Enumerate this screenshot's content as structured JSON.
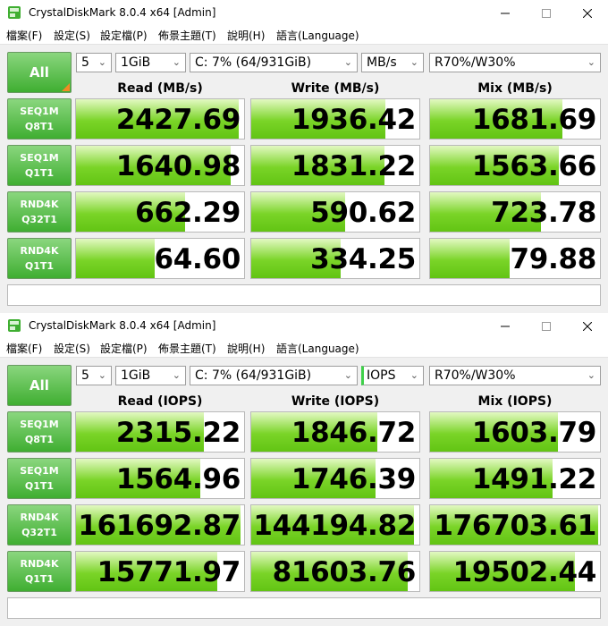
{
  "windows": [
    {
      "title": "CrystalDiskMark 8.0.4 x64 [Admin]",
      "menu": [
        "檔案(F)",
        "設定(S)",
        "設定檔(P)",
        "佈景主題(T)",
        "說明(H)",
        "語言(Language)"
      ],
      "all_label": "All",
      "controls": {
        "count": "5",
        "size": "1GiB",
        "drive": "C: 7% (64/931GiB)",
        "unit": "MB/s",
        "mix": "R70%/W30%"
      },
      "headers": {
        "read": "Read (MB/s)",
        "write": "Write (MB/s)",
        "mix": "Mix (MB/s)"
      },
      "rows": [
        {
          "l1": "SEQ1M",
          "l2": "Q8T1",
          "read": "2427.69",
          "write": "1936.42",
          "mix": "1681.69",
          "fill": [
            0.97,
            0.8,
            0.78
          ]
        },
        {
          "l1": "SEQ1M",
          "l2": "Q1T1",
          "read": "1640.98",
          "write": "1831.22",
          "mix": "1563.66",
          "fill": [
            0.92,
            0.79,
            0.76
          ]
        },
        {
          "l1": "RND4K",
          "l2": "Q32T1",
          "read": "662.29",
          "write": "590.62",
          "mix": "723.78",
          "fill": [
            0.65,
            0.56,
            0.65
          ]
        },
        {
          "l1": "RND4K",
          "l2": "Q1T1",
          "read": "64.60",
          "write": "334.25",
          "mix": "79.88",
          "fill": [
            0.47,
            0.53,
            0.47
          ]
        }
      ],
      "comment": ""
    },
    {
      "title": "CrystalDiskMark 8.0.4 x64 [Admin]",
      "menu": [
        "檔案(F)",
        "設定(S)",
        "設定檔(P)",
        "佈景主題(T)",
        "說明(H)",
        "語言(Language)"
      ],
      "all_label": "All",
      "controls": {
        "count": "5",
        "size": "1GiB",
        "drive": "C: 7% (64/931GiB)",
        "unit": "IOPS",
        "mix": "R70%/W30%"
      },
      "headers": {
        "read": "Read (IOPS)",
        "write": "Write (IOPS)",
        "mix": "Mix (IOPS)"
      },
      "rows": [
        {
          "l1": "SEQ1M",
          "l2": "Q8T1",
          "read": "2315.22",
          "write": "1846.72",
          "mix": "1603.79",
          "fill": [
            0.76,
            0.75,
            0.75
          ]
        },
        {
          "l1": "SEQ1M",
          "l2": "Q1T1",
          "read": "1564.96",
          "write": "1746.39",
          "mix": "1491.22",
          "fill": [
            0.74,
            0.74,
            0.72
          ]
        },
        {
          "l1": "RND4K",
          "l2": "Q32T1",
          "read": "161692.87",
          "write": "144194.82",
          "mix": "176703.61",
          "fill": [
            0.98,
            0.97,
            0.99
          ]
        },
        {
          "l1": "RND4K",
          "l2": "Q1T1",
          "read": "15771.97",
          "write": "81603.76",
          "mix": "19502.44",
          "fill": [
            0.84,
            0.93,
            0.85
          ]
        }
      ],
      "comment": ""
    }
  ],
  "colors": {
    "accent_green": "#3fae31",
    "bar_green": "#7ad427",
    "corner_orange": "#f08a24"
  }
}
